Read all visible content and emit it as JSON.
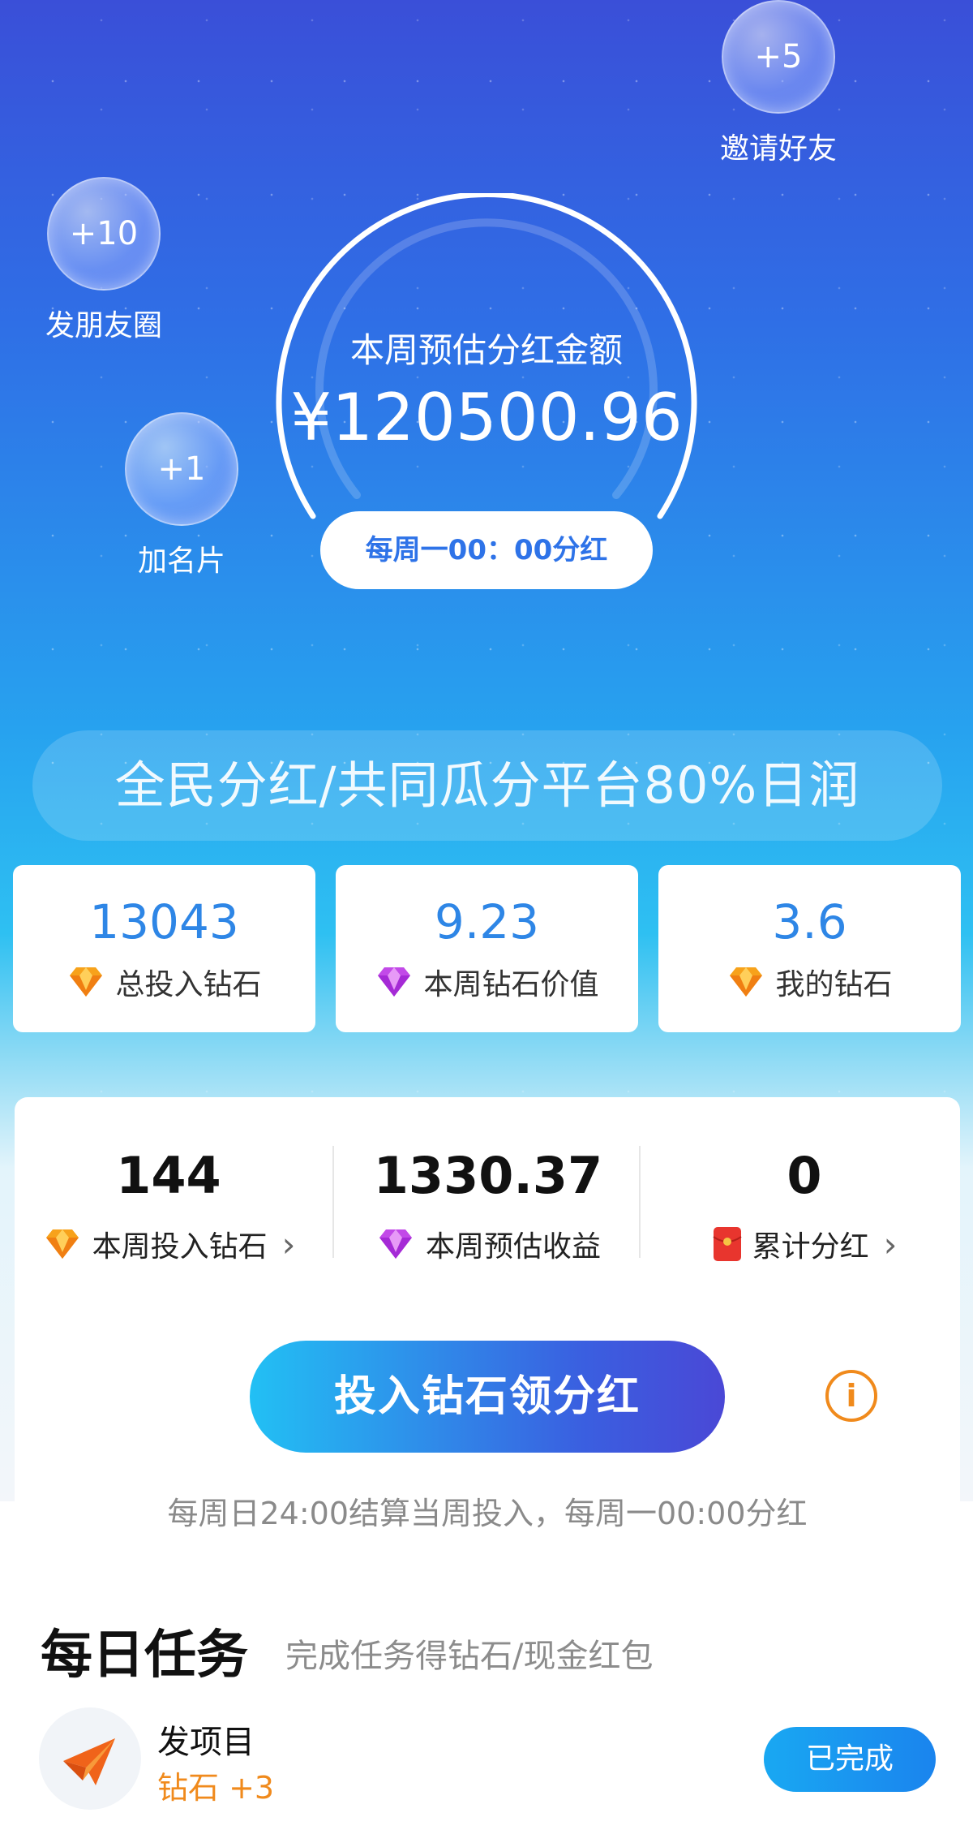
{
  "bubbles": {
    "invite": {
      "value": "+5",
      "label": "邀请好友"
    },
    "moments": {
      "value": "+10",
      "label": "发朋友圈"
    },
    "card": {
      "value": "+1",
      "label": "加名片"
    }
  },
  "dial": {
    "title": "本周预估分红金额",
    "amount": "¥120500.96",
    "schedule": "每周一00：00分红"
  },
  "slogan": "全民分红/共同瓜分平台80%日润",
  "stats": [
    {
      "value": "13043",
      "label": "总投入钻石",
      "icon": "orange-diamond-icon"
    },
    {
      "value": "9.23",
      "label": "本周钻石价值",
      "icon": "purple-diamond-icon"
    },
    {
      "value": "3.6",
      "label": "我的钻石",
      "icon": "orange-diamond-icon"
    }
  ],
  "weekly": [
    {
      "value": "144",
      "label": "本周投入钻石",
      "icon": "orange-diamond-icon"
    },
    {
      "value": "1330.37",
      "label": "本周预估收益",
      "icon": "purple-diamond-icon"
    },
    {
      "value": "0",
      "label": "累计分红",
      "icon": "red-envelope-icon"
    }
  ],
  "cta": {
    "label": "投入钻石领分红"
  },
  "settle_note": "每周日24:00结算当周投入，每周一00:00分红",
  "daily": {
    "title": "每日任务",
    "subtitle": "完成任务得钻石/现金红包",
    "tasks": [
      {
        "name": "发项目",
        "reward": "钻石 +3",
        "status": "已完成",
        "icon": "paper-plane-icon"
      }
    ]
  },
  "colors": {
    "accent_blue": "#2e86e6",
    "accent_orange": "#f08a1c",
    "purple": "#b437e6"
  }
}
